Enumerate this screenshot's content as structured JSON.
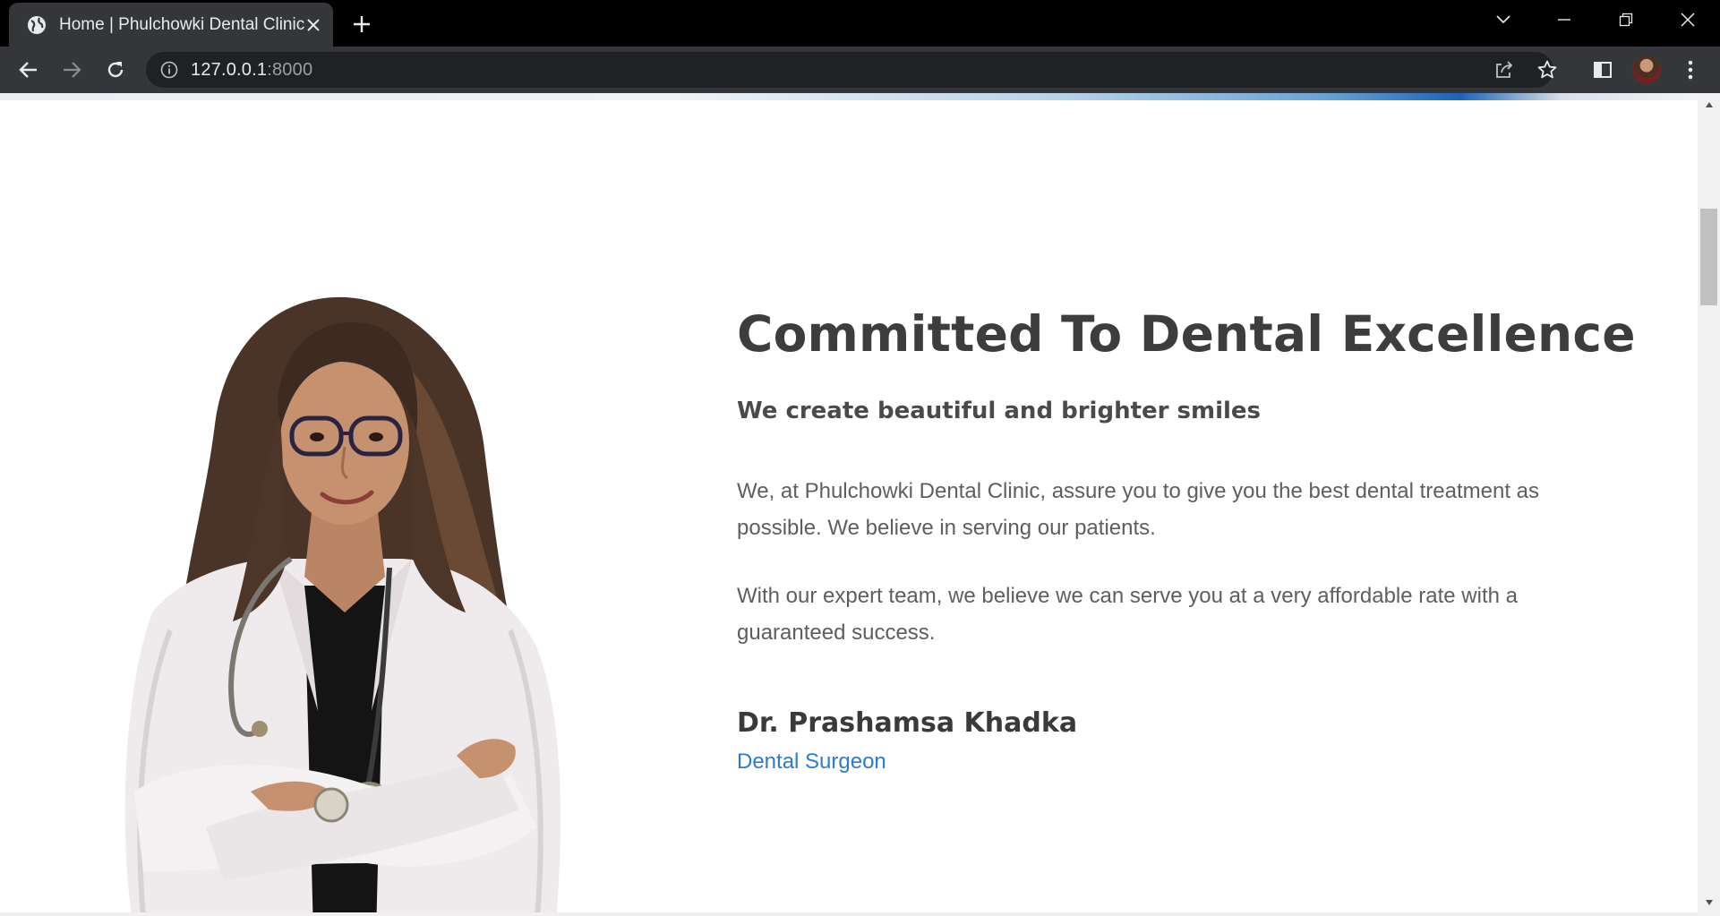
{
  "browser": {
    "tab_title": "Home | Phulchowki Dental Clinic",
    "url_host": "127.0.0.1",
    "url_port": ":8000"
  },
  "icons": {
    "favicon": "globe-icon",
    "tab_close": "close-icon",
    "new_tab": "plus-icon",
    "tab_search": "chevron-down-icon",
    "minimize": "minimize-icon",
    "restore": "restore-icon",
    "close_window": "close-icon",
    "back": "back-arrow-icon",
    "forward": "forward-arrow-icon",
    "reload": "reload-icon",
    "site_info": "info-icon",
    "share": "share-icon",
    "bookmark": "star-icon",
    "side_panel": "side-panel-icon",
    "menu": "kebab-menu-icon"
  },
  "about": {
    "headline": "Committed To Dental Excellence",
    "subheadline": "We create beautiful and brighter smiles",
    "paragraph1": "We, at Phulchowki Dental Clinic, assure you to give you the best dental treatment as possible. We believe in serving our patients.",
    "paragraph2": "With our expert team, we believe we can serve you at a very affordable rate with a guaranteed success.",
    "doctor_name": "Dr. Prashamsa Khadka",
    "doctor_role": "Dental Surgeon"
  },
  "colors": {
    "heading": "#3d3d3d",
    "body_text": "#5e5e5e",
    "accent_link": "#2b7bd0",
    "chrome_dark": "#35363a"
  }
}
